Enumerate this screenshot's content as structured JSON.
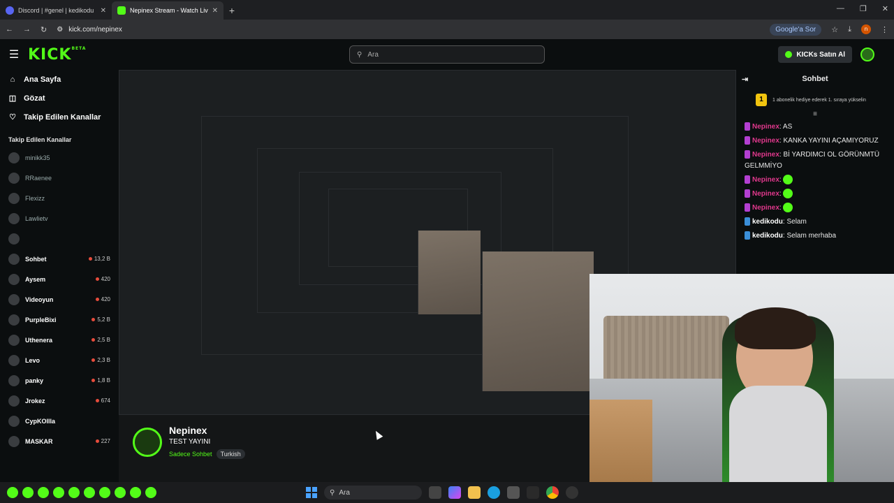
{
  "browser": {
    "tabs": [
      {
        "label": "Discord | #genel | kedikodu",
        "active": false,
        "color": "#5865f2"
      },
      {
        "label": "Nepinex Stream - Watch Live o",
        "active": true,
        "color": "#53fc18"
      }
    ],
    "new_tab": "+",
    "url": "kick.com/nepinex",
    "google_sor": "Google'a Sor",
    "profile_initial": "n"
  },
  "kick": {
    "logo": "KICK",
    "logo_sup": "BETA",
    "search_placeholder": "Ara",
    "buy_kicks": "KICKs Satın Al",
    "accent": "#53fc18"
  },
  "sidebar": {
    "nav": [
      {
        "icon": "home-icon",
        "glyph": "⌂",
        "label": "Ana Sayfa"
      },
      {
        "icon": "compass-icon",
        "glyph": "◫",
        "label": "Gözat"
      },
      {
        "icon": "heart-icon",
        "glyph": "♡",
        "label": "Takip Edilen Kanallar"
      }
    ],
    "section_title": "Takip Edilen Kanallar",
    "channels": [
      {
        "name": "minikk35",
        "live": false,
        "viewers": ""
      },
      {
        "name": "RRaenee",
        "live": false,
        "viewers": ""
      },
      {
        "name": "Flexizz",
        "live": false,
        "viewers": ""
      },
      {
        "name": "Lawlietv",
        "live": false,
        "viewers": ""
      },
      {
        "name": "",
        "live": false,
        "viewers": ""
      },
      {
        "name": "Sohbet",
        "live": true,
        "viewers": "13,2 B"
      },
      {
        "name": "Aysem",
        "live": true,
        "viewers": "420"
      },
      {
        "name": "Videoyun",
        "live": true,
        "viewers": "420"
      },
      {
        "name": "PurpleBixi",
        "live": true,
        "viewers": "5,2 B"
      },
      {
        "name": "Uthenera",
        "live": true,
        "viewers": "2,5 B"
      },
      {
        "name": "Levo",
        "live": true,
        "viewers": "2,3 B"
      },
      {
        "name": "panky",
        "live": true,
        "viewers": "1,8 B"
      },
      {
        "name": "Jrokez",
        "live": true,
        "viewers": "674"
      },
      {
        "name": "CypKOllla",
        "live": true,
        "viewers": ""
      },
      {
        "name": "MASKAR",
        "live": true,
        "viewers": "227"
      }
    ]
  },
  "stream": {
    "streamer": "Nepinex",
    "title": "TEST YAYINI",
    "category": "Sadece Sohbet",
    "tag": "Turkish"
  },
  "chat": {
    "title": "Sohbet",
    "sub_note": "1 abonelik hediye ederek 1. sıraya yükselin",
    "sub_rank": "1",
    "messages": [
      {
        "user": "Nepinex",
        "type": "np",
        "text": "AS"
      },
      {
        "user": "Nepinex",
        "type": "np",
        "text": "KANKA YAYINI AÇAMIYORUZ"
      },
      {
        "user": "Nepinex",
        "type": "np",
        "text": "Bİ YARDIMCI OL GÖRÜNMTÜ GELMMİYO"
      },
      {
        "user": "Nepinex",
        "type": "np",
        "text": ""
      },
      {
        "user": "Nepinex",
        "type": "np",
        "text": ""
      },
      {
        "user": "Nepinex",
        "type": "np",
        "text": ""
      },
      {
        "user": "kedikodu",
        "type": "kk",
        "text": "Selam"
      },
      {
        "user": "kedikodu",
        "type": "kk",
        "text": "Selam merhaba"
      }
    ]
  },
  "taskbar": {
    "search_placeholder": "Ara"
  }
}
